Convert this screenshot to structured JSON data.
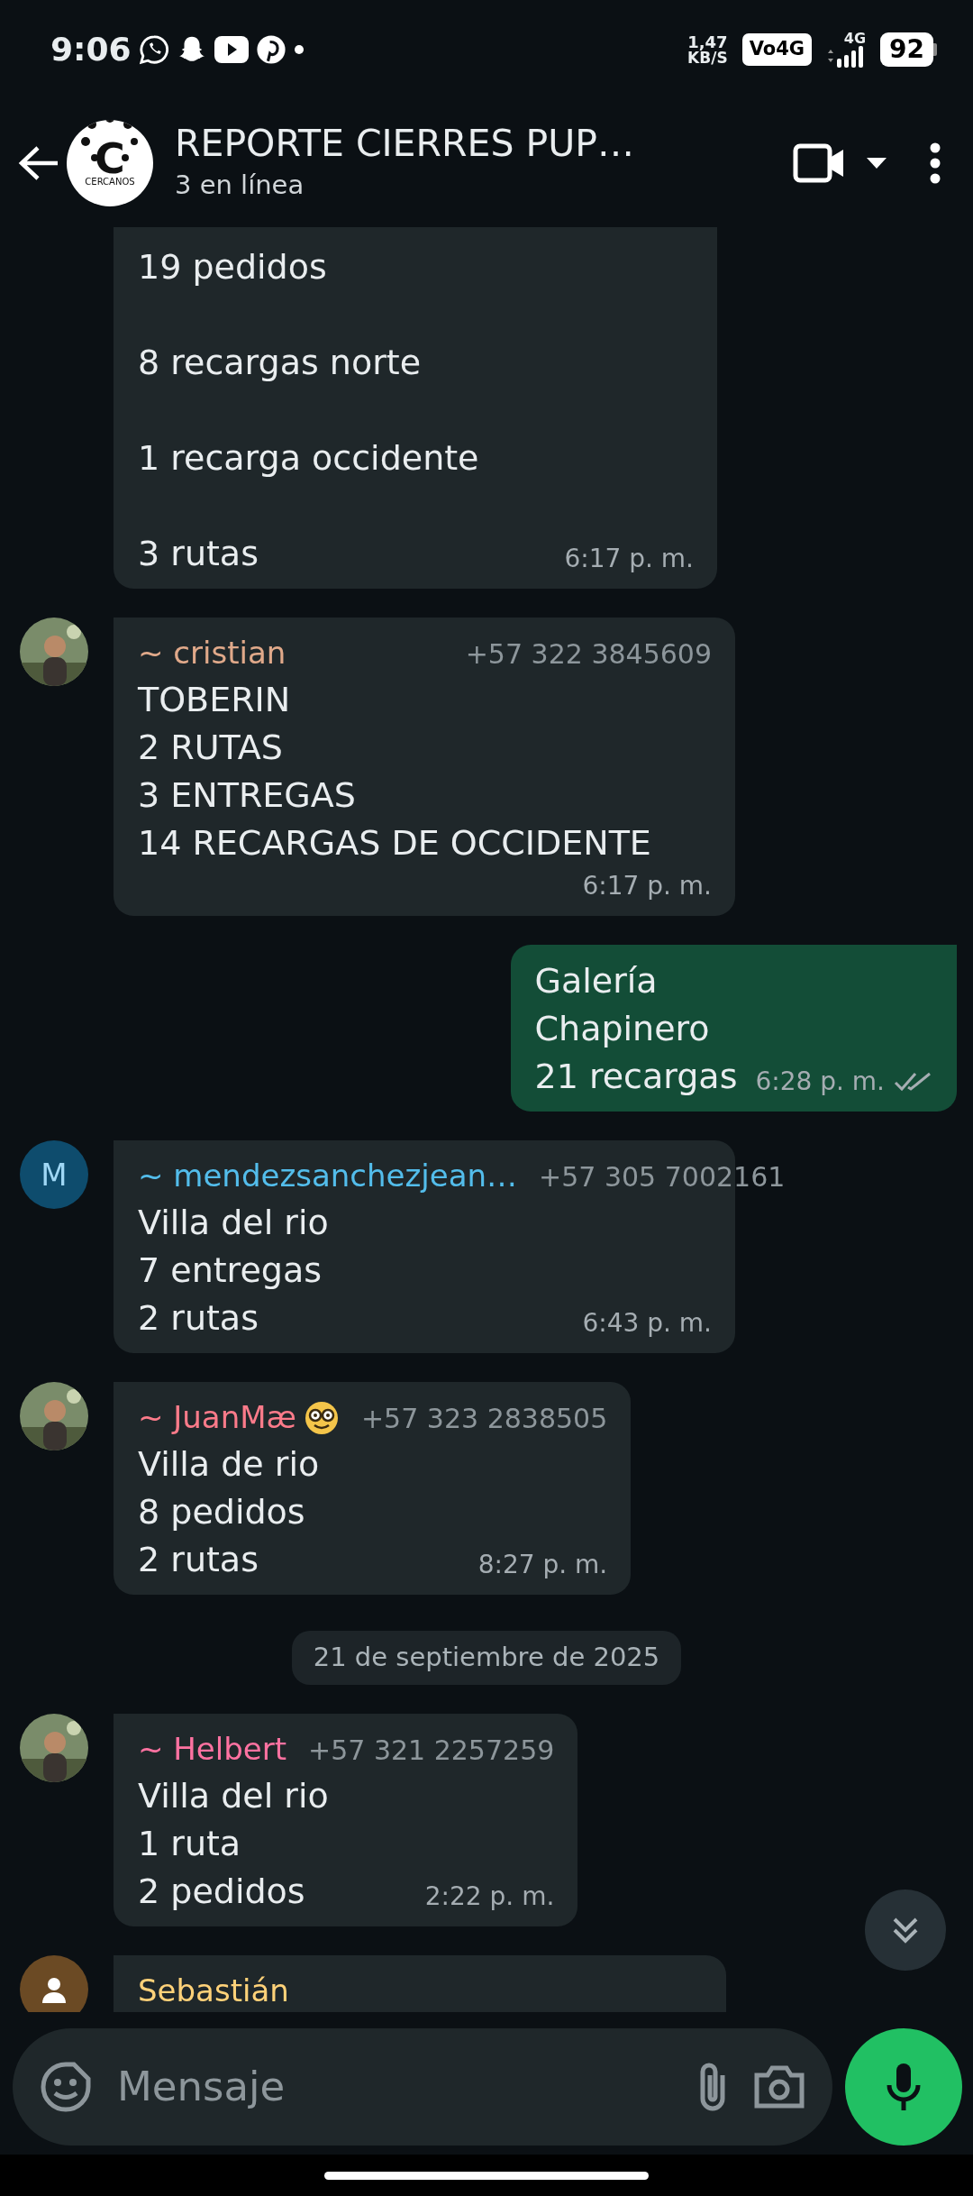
{
  "status_bar": {
    "time": "9:06",
    "speed_value": "1,47",
    "speed_unit": "KB/S",
    "volte": "Vo4G",
    "network": "4G",
    "battery": "92"
  },
  "header": {
    "title": "REPORTE CIERRES PUP…",
    "subtitle": "3 en línea",
    "logo_letter": "C",
    "logo_text": "CERCANOS"
  },
  "messages": [
    {
      "kind": "incoming",
      "text": "19 pedidos\n\n8 recargas norte\n\n1 recarga occidente\n\n3 rutas",
      "time": "6:17 p. m."
    },
    {
      "kind": "incoming",
      "sender": "~ cristian",
      "color": "#e0a98a",
      "phone": "+57 322 3845609",
      "text": "TOBERIN\n2 RUTAS\n3 ENTREGAS\n14 RECARGAS DE OCCIDENTE",
      "time": "6:17 p. m."
    },
    {
      "kind": "outgoing",
      "text": "Galería\nChapinero\n21 recargas",
      "time": "6:28 p. m.",
      "read": false
    },
    {
      "kind": "incoming",
      "sender": "~ mendezsanchezjean…",
      "color": "#53bdeb",
      "phone": "+57 305 7002161",
      "avatar": {
        "kind": "initial",
        "initial": "M"
      },
      "text": "Villa del rio\n7 entregas\n2 rutas",
      "time": "6:43 p. m."
    },
    {
      "kind": "incoming",
      "sender": "~ JuanMæ",
      "color": "#fc7b8a",
      "badge": {
        "kind": "nerd-face"
      },
      "phone": "+57 323 2838505",
      "text": "Villa de rio\n8 pedidos\n2 rutas",
      "time": "8:27 p. m."
    },
    {
      "kind": "date",
      "text": "21 de septiembre de 2025"
    },
    {
      "kind": "incoming",
      "sender": "~ Helbert",
      "color": "#ff72a1",
      "phone": "+57 321 2257259",
      "text": "Villa del rio\n1 ruta\n2 pedidos",
      "time": "2:22 p. m."
    },
    {
      "kind": "incoming",
      "sender": "Sebastián",
      "color": "#ffd279",
      "avatar": {
        "kind": "default"
      }
    }
  ],
  "composer": {
    "placeholder": "Mensaje"
  }
}
